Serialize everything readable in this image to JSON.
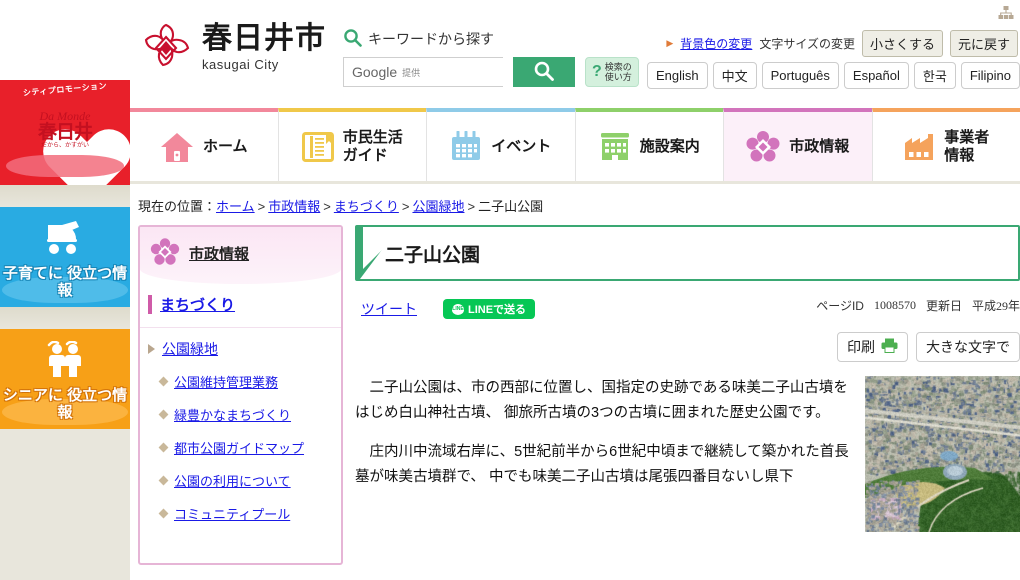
{
  "site": {
    "logo_jp": "春日井市",
    "logo_en": "kasugai City",
    "sitemap_icon": "sitemap-icon"
  },
  "search": {
    "keyword_label": "キーワードから探す",
    "search_icon": "search-icon",
    "input_value": "Google",
    "input_sub": "提供",
    "submit_icon": "search-icon",
    "help_mark": "?",
    "help_line1": "検索の",
    "help_line2": "使い方"
  },
  "utility": {
    "bg_arrow": "▶",
    "bg_change": "背景色の変更",
    "font_size_label": "文字サイズの変更",
    "smaller": "小さくする",
    "reset": "元に戻す"
  },
  "languages": [
    "English",
    "中文",
    "Português",
    "Español",
    "한국",
    "Filipino"
  ],
  "gnav": [
    {
      "label": "ホーム",
      "color": "#f2889b",
      "icon": "home-icon",
      "active": false
    },
    {
      "label": "市民生活\nガイド",
      "color": "#f0c84a",
      "icon": "book-icon",
      "active": false
    },
    {
      "label": "イベント",
      "color": "#8fcbe8",
      "icon": "calendar-icon",
      "active": false
    },
    {
      "label": "施設案内",
      "color": "#8ed06a",
      "icon": "building-icon",
      "active": false
    },
    {
      "label": "市政情報",
      "color": "#d274bc",
      "icon": "flower-icon",
      "active": true
    },
    {
      "label": "事業者\n情報",
      "color": "#f5a35c",
      "icon": "factory-icon",
      "active": false
    }
  ],
  "rail": {
    "promo": {
      "arc": "シティプロモーション",
      "da": "Da Monde",
      "jp": "春日井",
      "sub": "だから、かすがい"
    },
    "kosodate": {
      "icon": "stroller-icon",
      "label": "子育てに\n役立つ情報"
    },
    "senior": {
      "icon": "seniors-icon",
      "label": "シニアに\n役立つ情報"
    }
  },
  "breadcrumb": {
    "prefix": "現在の位置：",
    "items": [
      "ホーム",
      "市政情報",
      "まちづくり",
      "公園緑地"
    ],
    "current": "二子山公園",
    "separator": ">"
  },
  "sidebar": {
    "heading": "市政情報",
    "heading_icon": "flower-icon",
    "current": "まちづくり",
    "parent": "公園緑地",
    "children": [
      "公園維持管理業務",
      "緑豊かなまちづくり",
      "都市公園ガイドマップ",
      "公園の利用について",
      "コミュニティプール"
    ]
  },
  "article": {
    "title": "二子山公園",
    "tweet_label": "ツイート",
    "line_label": "LINEで送る",
    "line_icon": "line-icon",
    "page_id_label": "ページID",
    "page_id_value": "1008570",
    "updated_label": "更新日",
    "updated_value": "平成29年",
    "print_label": "印刷",
    "print_icon": "printer-icon",
    "large_text_label": "大きな文字で",
    "paragraphs": [
      "二子山公園は、市の西部に位置し、国指定の史跡である味美二子山古墳をはじめ白山神社古墳、 御旅所古墳の3つの古墳に囲まれた歴史公園です。",
      "庄内川中流域右岸に、5世紀前半から6世紀中頃まで継続して築かれた首長墓が味美古墳群で、 中でも味美二子山古墳は尾張四番目ないし県下"
    ],
    "photo_alt": "二子山公園の航空写真"
  },
  "colors": {
    "brand_green": "#3aa873",
    "brand_pink": "#d274bc",
    "link_blue": "#1a1ae6",
    "line_green": "#06c755",
    "promo_red": "#e8202a",
    "kosodate_blue": "#29abe2",
    "senior_orange": "#f7a017"
  }
}
